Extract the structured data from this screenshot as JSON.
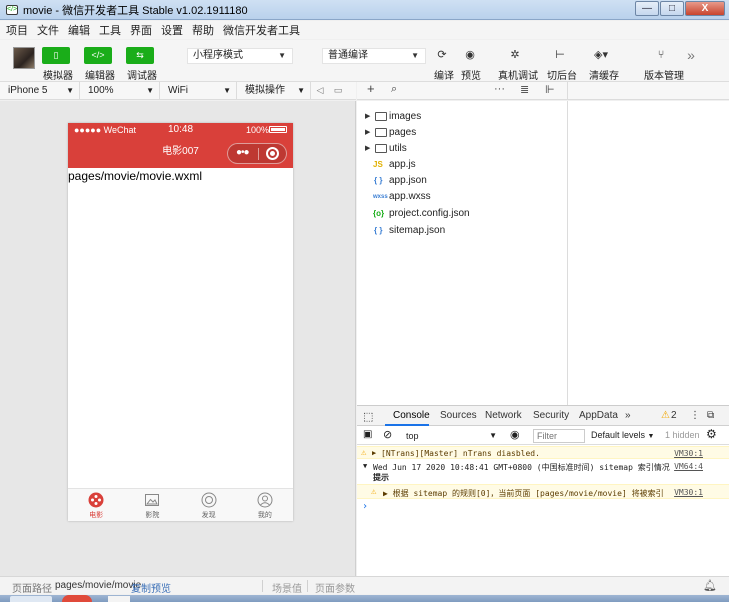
{
  "window": {
    "title": "movie - 微信开发者工具 Stable v1.02.1911180",
    "buttons": [
      "—",
      "□",
      "X"
    ]
  },
  "menu": [
    "项目",
    "文件",
    "编辑",
    "工具",
    "界面",
    "设置",
    "帮助",
    "微信开发者工具"
  ],
  "toolbar": {
    "simulator": "模拟器",
    "editor": "编辑器",
    "debugger": "调试器",
    "mode": "小程序模式",
    "compile_mode": "普通编译",
    "compile": "编译",
    "preview": "预览",
    "real_debug": "真机调试",
    "background": "切后台",
    "clear_cache": "清缓存",
    "version": "版本管理",
    "more": "»"
  },
  "device_bar": {
    "device": "iPhone 5",
    "zoom": "100%",
    "network": "WiFi",
    "operation": "模拟操作"
  },
  "phone": {
    "carrier": "●●●●● WeChat",
    "time": "10:48",
    "battery": "100%",
    "nav_title": "电影007",
    "body_text": "pages/movie/movie.wxml",
    "accent_color": "#d9403a",
    "tabs": [
      {
        "label": "电影",
        "icon": "movie-icon",
        "active": true
      },
      {
        "label": "影院",
        "icon": "cinema-icon",
        "active": false
      },
      {
        "label": "发现",
        "icon": "discover-icon",
        "active": false
      },
      {
        "label": "我的",
        "icon": "profile-icon",
        "active": false
      }
    ]
  },
  "filetree": [
    {
      "name": "images",
      "type": "folder"
    },
    {
      "name": "pages",
      "type": "folder"
    },
    {
      "name": "utils",
      "type": "folder"
    },
    {
      "name": "app.js",
      "type": "js",
      "badge": "JS"
    },
    {
      "name": "app.json",
      "type": "json",
      "badge": "{ }"
    },
    {
      "name": "app.wxss",
      "type": "wxss",
      "badge": "wxss"
    },
    {
      "name": "project.config.json",
      "type": "config",
      "badge": "{o}"
    },
    {
      "name": "sitemap.json",
      "type": "json",
      "badge": "{ }"
    }
  ],
  "devtools": {
    "tabs": [
      "Console",
      "Sources",
      "Network",
      "Security",
      "AppData"
    ],
    "more": "»",
    "warn_count": "2",
    "context": "top",
    "filter_placeholder": "Filter",
    "levels": "Default levels",
    "hidden": "1 hidden",
    "logs": [
      {
        "text": "[NTrans][Master] nTrans diasbled.",
        "src": "VM30:1"
      },
      {
        "text": "Wed Jun 17 2020 10:48:41 GMT+0800 (中国标准时间) sitemap 索引情况",
        "text2": "提示",
        "src": "VM64:4"
      },
      {
        "text": "▶ 根据 sitemap 的规则[0]，当前页面 [pages/movie/movie] 将被索引",
        "src": "VM30:1"
      }
    ],
    "prompt": "›"
  },
  "statusbar": {
    "path_label": "页面路径",
    "path": "pages/movie/movie",
    "copy": "复制",
    "preview": "预览",
    "scene": "场景值",
    "params": "页面参数"
  }
}
